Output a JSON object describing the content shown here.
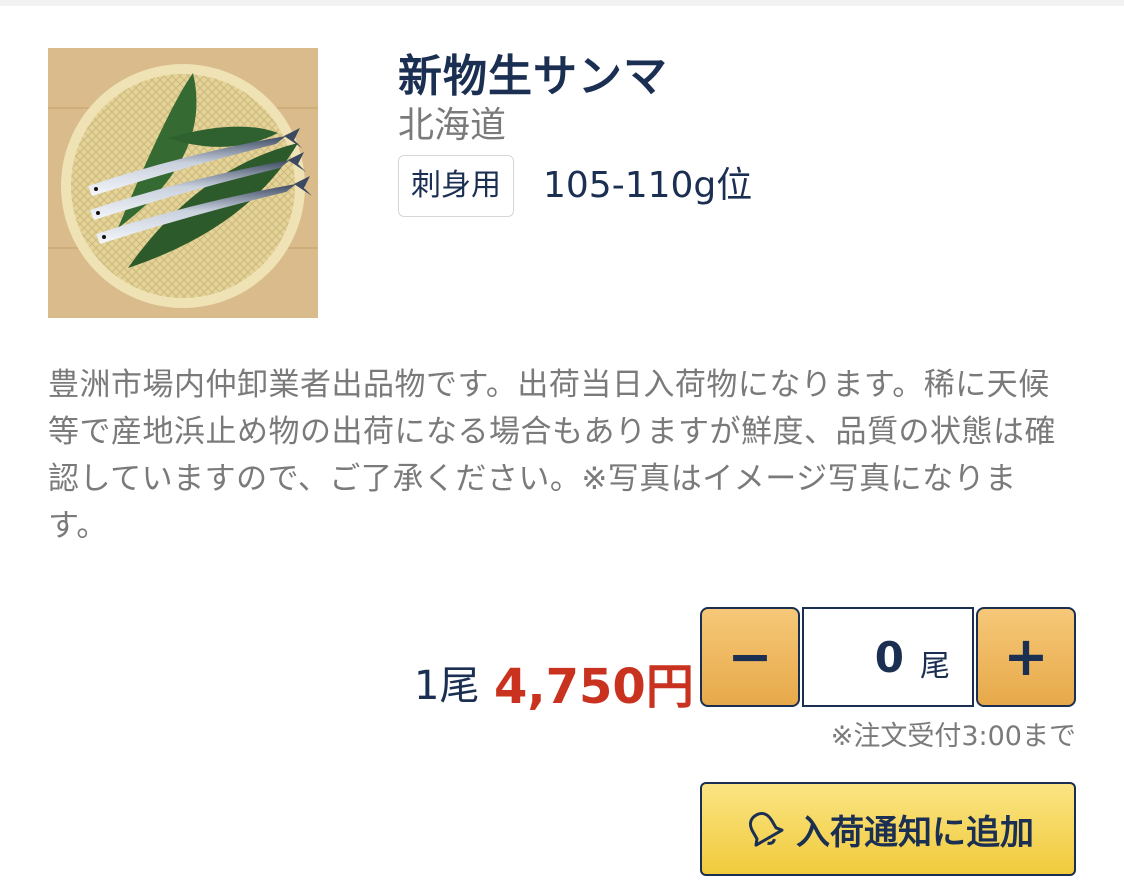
{
  "product": {
    "name": "新物生サンマ",
    "origin": "北海道",
    "usage_tag": "刺身用",
    "size": "105-110g位",
    "image_icon": "sanma-photo",
    "description": "豊洲市場内仲卸業者出品物です。出荷当日入荷物になります。稀に天候等で産地浜止め物の出荷になる場合もありますが鮮度、品質の状態は確認していますので、ご了承ください。※写真はイメージ写真になります。"
  },
  "price": {
    "unit": "1尾",
    "amount": "4,750円",
    "amount_color": "#c8321f"
  },
  "quantity": {
    "minus_label": "−",
    "value": "0",
    "unit": "尾",
    "plus_label": "+",
    "deadline_note": "※注文受付3:00まで",
    "button_color": "#eeb55c"
  },
  "notify": {
    "icon": "bell-icon",
    "label": "入荷通知に追加",
    "button_color": "#f5d65a"
  },
  "theme": {
    "primary_text": "#1b2f52",
    "secondary_text": "#7a7a7a"
  }
}
